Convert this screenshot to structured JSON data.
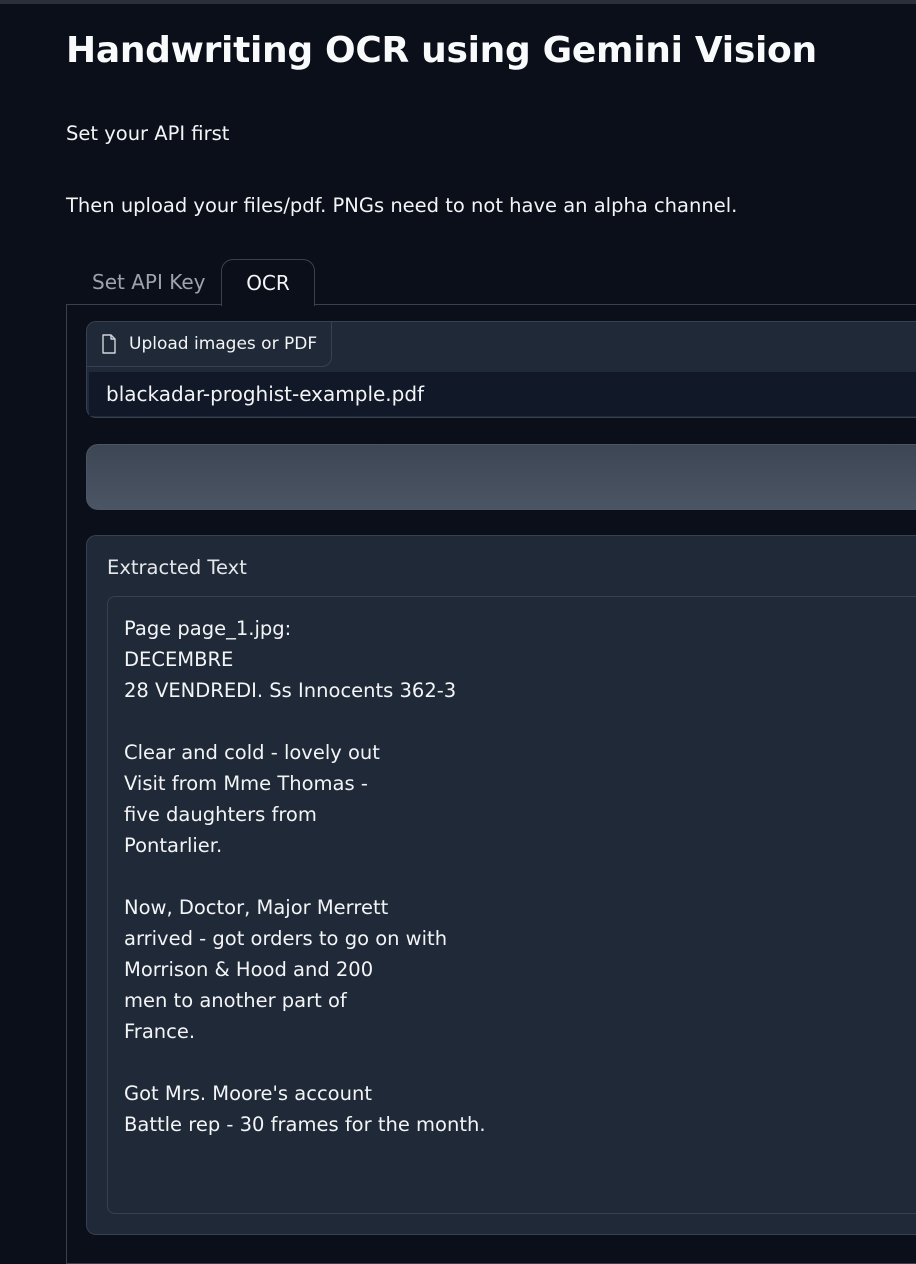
{
  "header": {
    "title": "Handwriting OCR using Gemini Vision",
    "instruction_1": "Set your API first",
    "instruction_2": "Then upload your files/pdf. PNGs need to not have an alpha channel."
  },
  "tabs": [
    {
      "label": "Set API Key",
      "selected": false
    },
    {
      "label": "OCR",
      "selected": true
    }
  ],
  "upload": {
    "button_label": "Upload images or PDF",
    "button_icon": "file-icon",
    "file_name": "blackadar-proghist-example.pdf"
  },
  "submit": {
    "label": ""
  },
  "output": {
    "label": "Extracted Text",
    "text": "Page page_1.jpg:\nDECEMBRE\n28 VENDREDI. Ss Innocents 362-3\n\nClear and cold - lovely out\nVisit from Mme Thomas -\nfive daughters from\nPontarlier.\n\nNow, Doctor, Major Merrett\narrived - got orders to go on with\nMorrison & Hood and 200\nmen to another part of\nFrance.\n\nGot Mrs. Moore's account\nBattle rep - 30 frames for the month."
  },
  "colors": {
    "background": "#0b0f19",
    "panel": "#1f2937",
    "border": "#374151",
    "text": "#f3f4f6",
    "muted_text": "#9ca3af"
  }
}
